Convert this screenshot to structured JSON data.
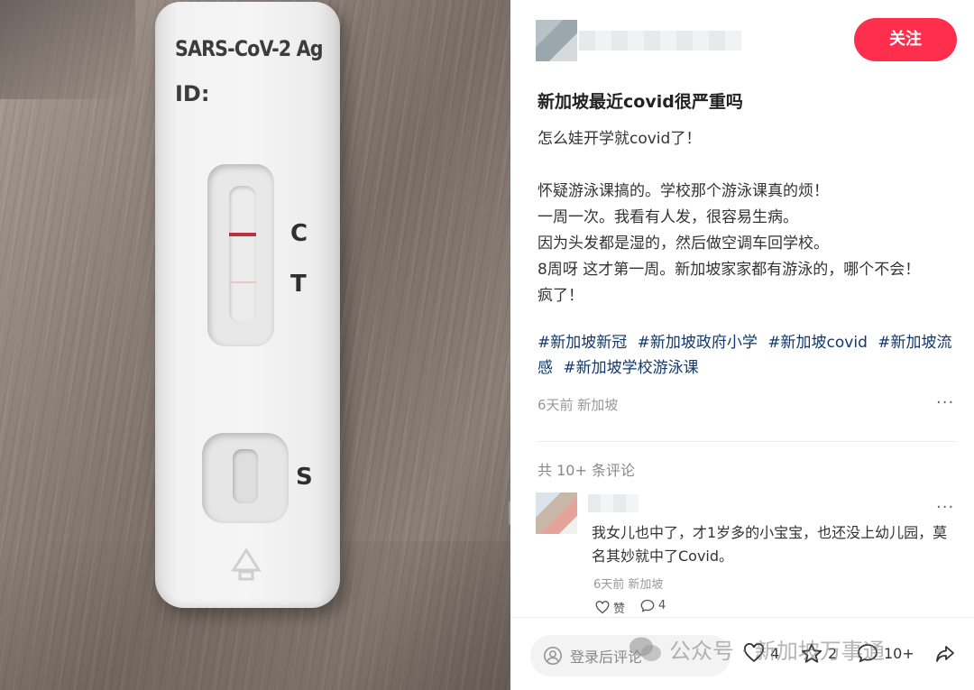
{
  "photo": {
    "cassette_brand": "SARS-CoV-2 Ag",
    "cassette_id_label": "ID:",
    "label_c": "C",
    "label_t": "T",
    "label_s": "S"
  },
  "post": {
    "follow_label": "关注",
    "title": "新加坡最近covid很严重吗",
    "body_lines": [
      "怎么娃开学就covid了！",
      "",
      "怀疑游泳课搞的。学校那个游泳课真的烦！",
      "一周一次。我看有人发，很容易生病。",
      "因为头发都是湿的，然后做空调车回学校。",
      "8周呀 这才第一周。新加坡家家都有游泳的，哪个不会！",
      "疯了！"
    ],
    "tags": [
      "#新加坡新冠",
      "#新加坡政府小学",
      "#新加坡covid",
      "#新加坡流感",
      "#新加坡学校游泳课"
    ],
    "meta": "6天前 新加坡",
    "more": "···"
  },
  "comments": {
    "count_text": "共 10+ 条评论",
    "items": [
      {
        "text": "我女儿也中了，才1岁多的小宝宝，也还没上幼儿园，莫名其妙就中了Covid。",
        "meta": "6天前 新加坡",
        "like_label": "赞",
        "reply_count": "4",
        "more": "···"
      }
    ]
  },
  "bottom_bar": {
    "input_placeholder": "登录后评论",
    "like_count": "4",
    "star_count": "2",
    "comment_count": "10+"
  },
  "watermark": "公众号 · 新加坡万事通",
  "colors": {
    "accent": "#ff2e4d",
    "tag": "#13386c",
    "test_line": "#c0303c"
  }
}
